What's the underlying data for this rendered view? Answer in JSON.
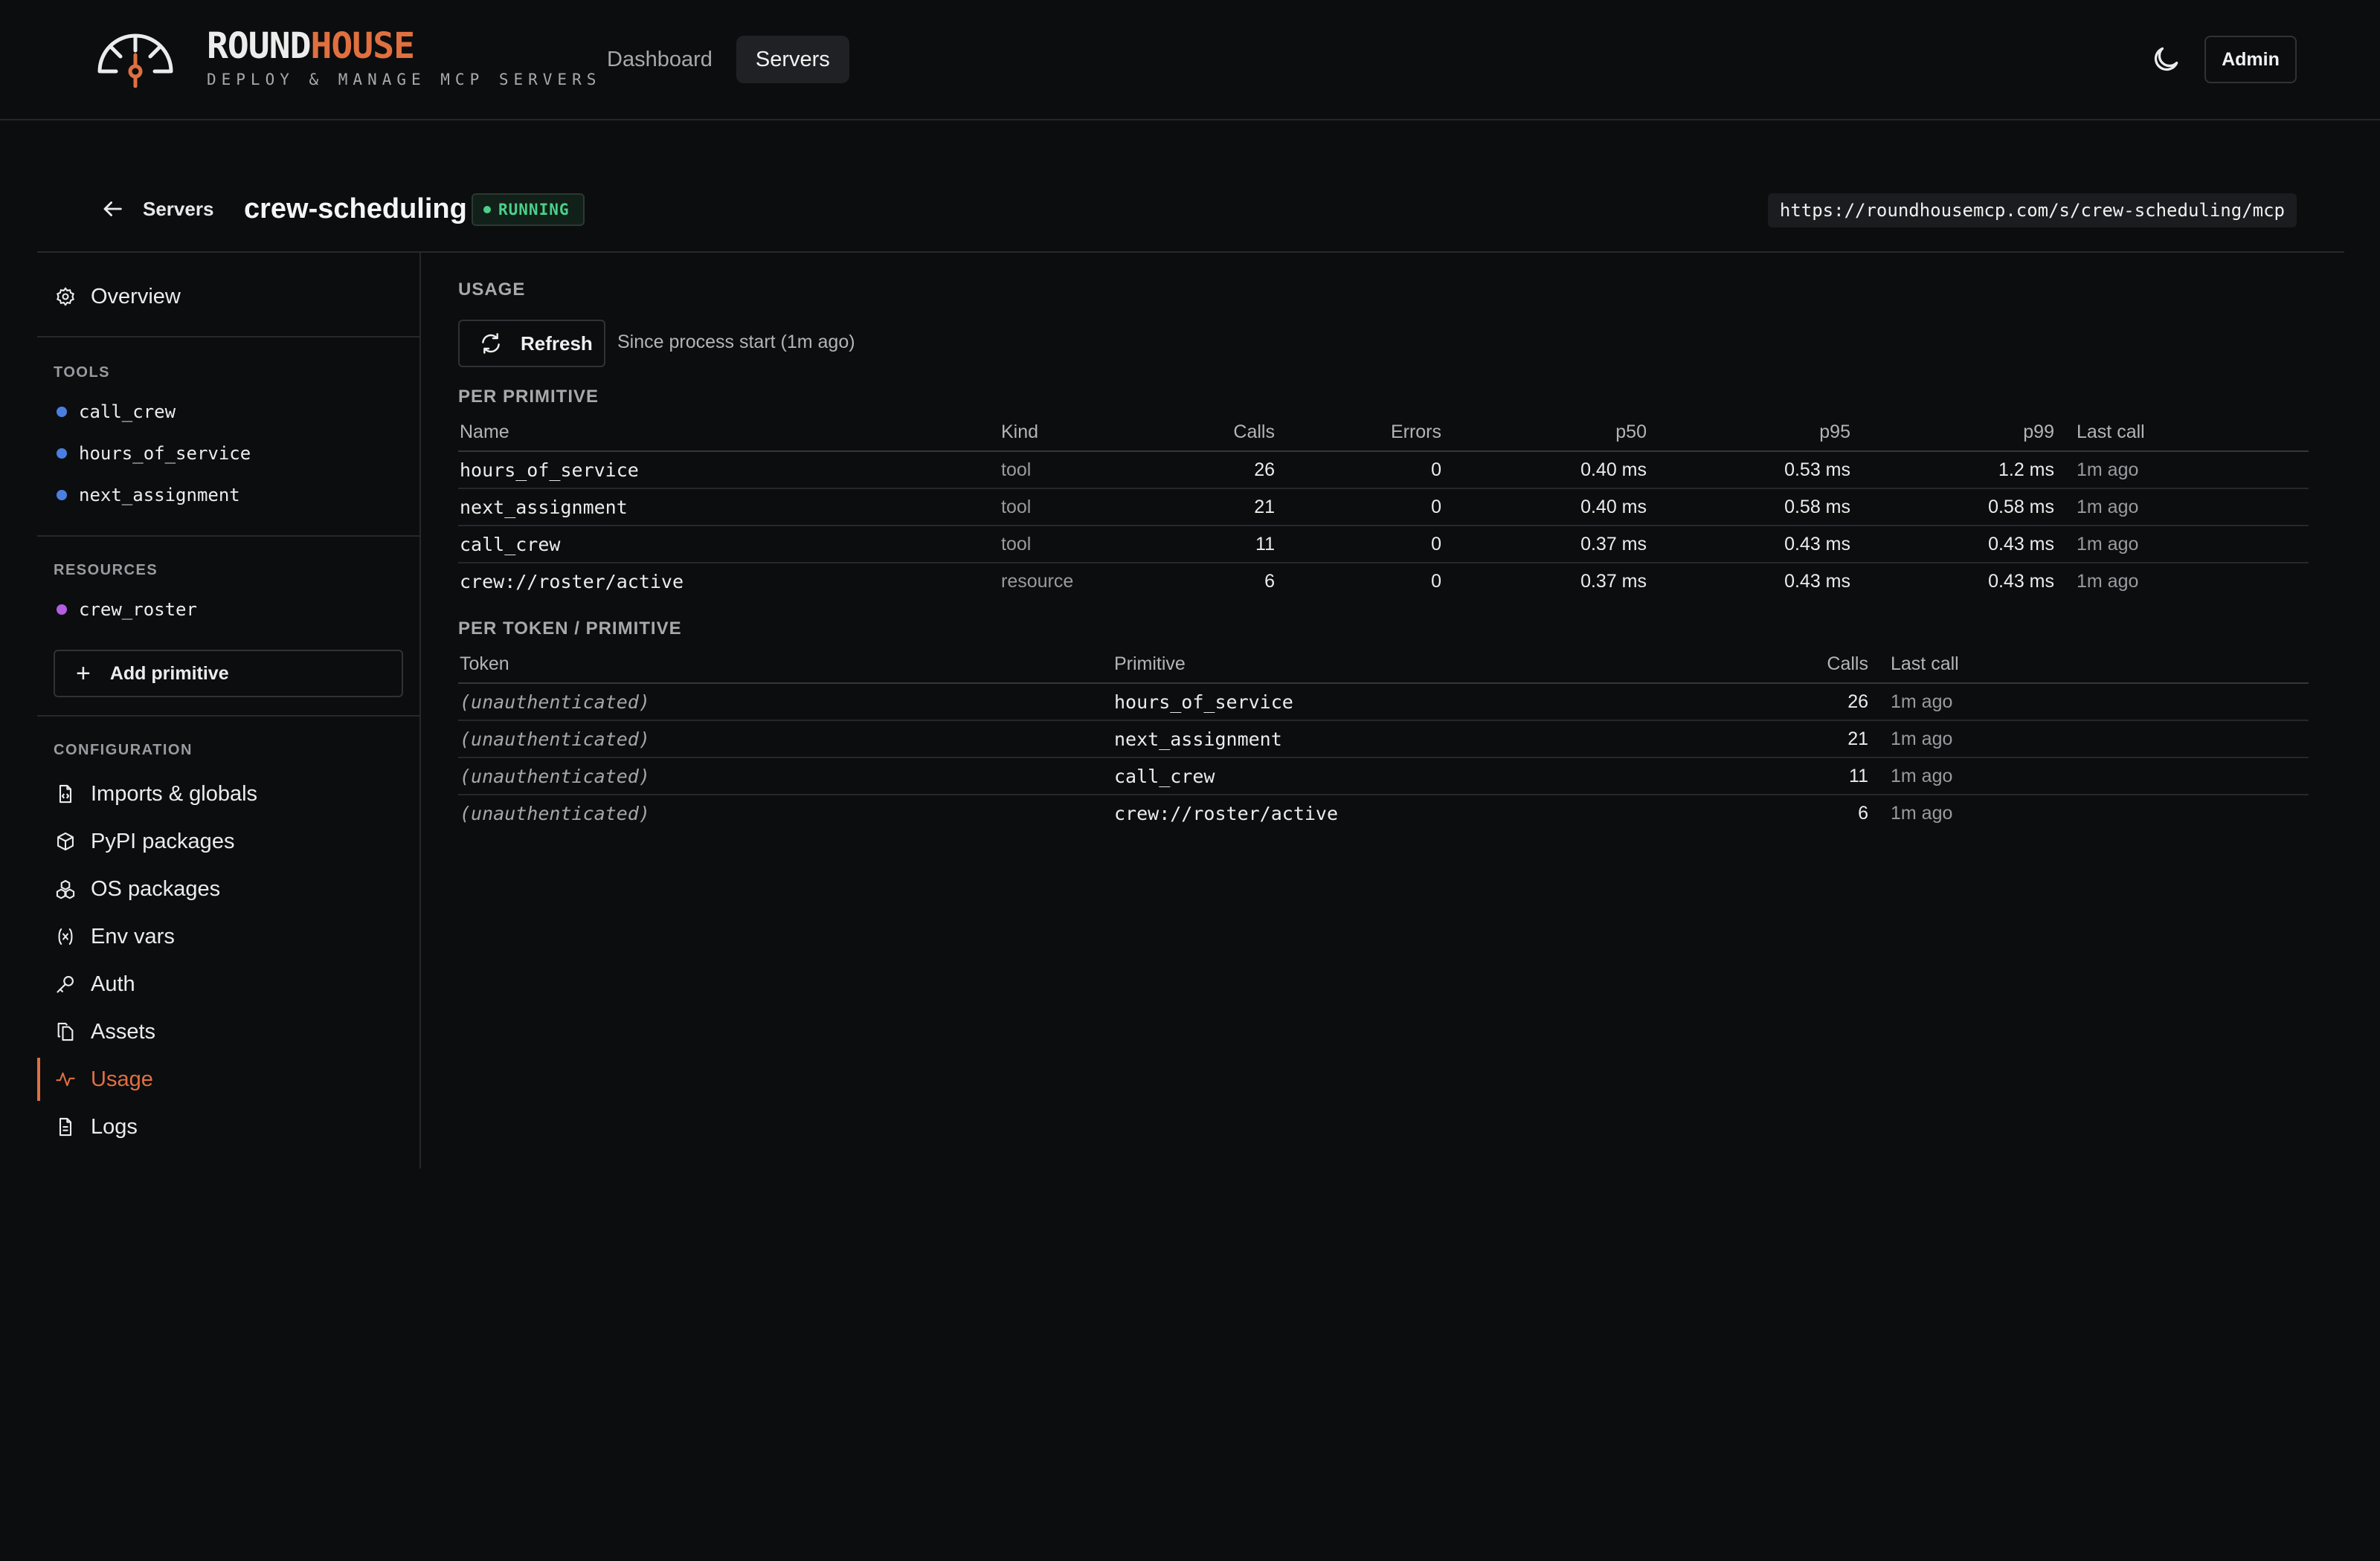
{
  "header": {
    "brand_part1": "ROUND",
    "brand_part2": "HOUSE",
    "tagline": "DEPLOY & MANAGE MCP SERVERS",
    "nav": [
      {
        "label": "Dashboard",
        "active": false
      },
      {
        "label": "Servers",
        "active": true
      }
    ],
    "admin_label": "Admin"
  },
  "subheader": {
    "back_label": "Servers",
    "server_name": "crew-scheduling",
    "status": "RUNNING",
    "url": "https://roundhousemcp.com/s/crew-scheduling/mcp"
  },
  "sidebar": {
    "overview": "Overview",
    "tools_heading": "TOOLS",
    "tools": [
      "call_crew",
      "hours_of_service",
      "next_assignment"
    ],
    "resources_heading": "RESOURCES",
    "resources": [
      "crew_roster"
    ],
    "add_primitive": "Add primitive",
    "config_heading": "CONFIGURATION",
    "config": [
      {
        "label": "Imports & globals",
        "icon": "file-code-icon"
      },
      {
        "label": "PyPI packages",
        "icon": "package-icon"
      },
      {
        "label": "OS packages",
        "icon": "boxes-icon"
      },
      {
        "label": "Env vars",
        "icon": "variable-icon"
      },
      {
        "label": "Auth",
        "icon": "key-icon"
      },
      {
        "label": "Assets",
        "icon": "files-icon"
      },
      {
        "label": "Usage",
        "icon": "activity-icon",
        "active": true
      },
      {
        "label": "Logs",
        "icon": "file-text-icon"
      }
    ],
    "colors": {
      "tool_dot": "#4a7fe0",
      "resource_dot": "#b45de0",
      "accent": "#e0703f"
    }
  },
  "main": {
    "usage_title": "USAGE",
    "refresh_label": "Refresh",
    "since_text": "Since process start (1m ago)",
    "per_primitive_title": "PER PRIMITIVE",
    "per_primitive_columns": [
      "Name",
      "Kind",
      "Calls",
      "Errors",
      "p50",
      "p95",
      "p99",
      "Last call"
    ],
    "per_primitive_rows": [
      [
        "hours_of_service",
        "tool",
        "26",
        "0",
        "0.40 ms",
        "0.53 ms",
        "1.2 ms",
        "1m ago"
      ],
      [
        "next_assignment",
        "tool",
        "21",
        "0",
        "0.40 ms",
        "0.58 ms",
        "0.58 ms",
        "1m ago"
      ],
      [
        "call_crew",
        "tool",
        "11",
        "0",
        "0.37 ms",
        "0.43 ms",
        "0.43 ms",
        "1m ago"
      ],
      [
        "crew://roster/active",
        "resource",
        "6",
        "0",
        "0.37 ms",
        "0.43 ms",
        "0.43 ms",
        "1m ago"
      ]
    ],
    "per_token_title": "PER TOKEN / PRIMITIVE",
    "per_token_columns": [
      "Token",
      "Primitive",
      "Calls",
      "Last call"
    ],
    "per_token_rows": [
      [
        "(unauthenticated)",
        "hours_of_service",
        "26",
        "1m ago"
      ],
      [
        "(unauthenticated)",
        "next_assignment",
        "21",
        "1m ago"
      ],
      [
        "(unauthenticated)",
        "call_crew",
        "11",
        "1m ago"
      ],
      [
        "(unauthenticated)",
        "crew://roster/active",
        "6",
        "1m ago"
      ]
    ]
  }
}
